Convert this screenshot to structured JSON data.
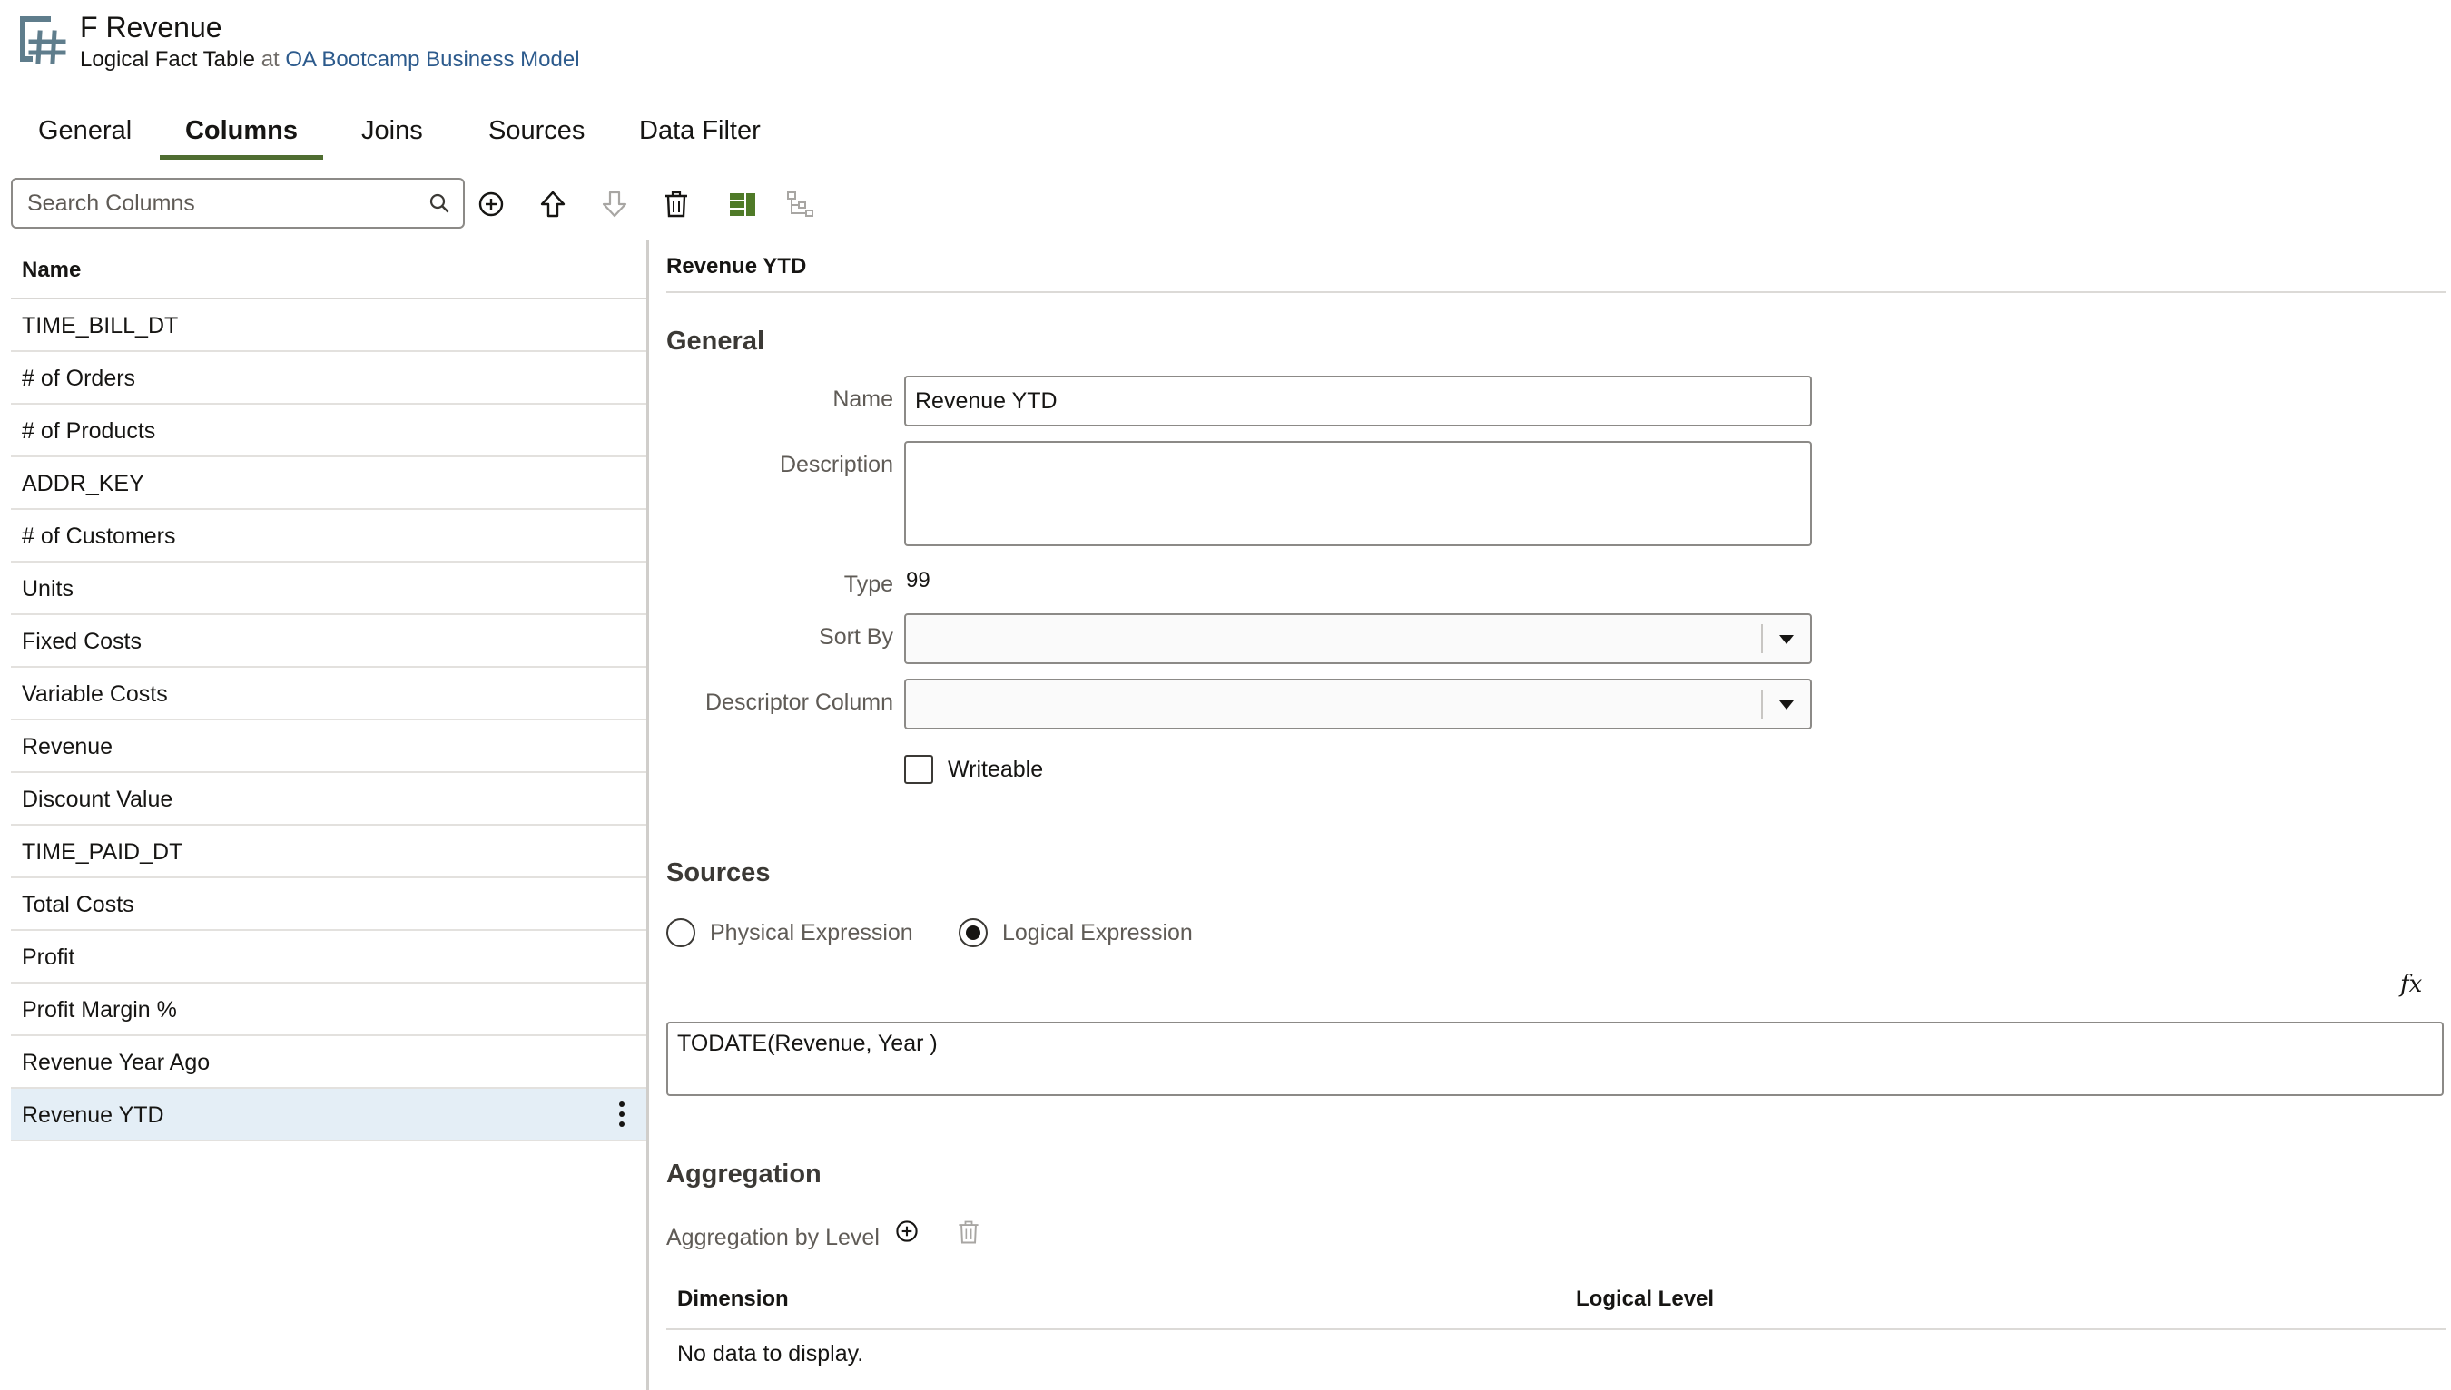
{
  "header": {
    "title": "F Revenue",
    "subtitle_type": "Logical Fact Table",
    "subtitle_at": "at",
    "subtitle_link": "OA Bootcamp Business Model"
  },
  "tabs": [
    {
      "label": "General"
    },
    {
      "label": "Columns"
    },
    {
      "label": "Joins"
    },
    {
      "label": "Sources"
    },
    {
      "label": "Data Filter"
    }
  ],
  "active_tab": "Columns",
  "toolbar": {
    "search_placeholder": "Search Columns",
    "icons": [
      "search-icon",
      "add-circle-icon",
      "move-up-icon",
      "move-down-icon",
      "delete-icon",
      "columns-view-icon",
      "hierarchy-icon"
    ]
  },
  "columns_list": {
    "header": "Name",
    "items": [
      "TIME_BILL_DT",
      "# of Orders",
      "# of Products",
      "ADDR_KEY",
      "# of Customers",
      "Units",
      "Fixed Costs",
      "Variable Costs",
      "Revenue",
      "Discount Value",
      "TIME_PAID_DT",
      "Total Costs",
      "Profit",
      "Profit Margin %",
      "Revenue Year Ago",
      "Revenue YTD"
    ],
    "selected": "Revenue YTD"
  },
  "detail": {
    "title": "Revenue YTD",
    "general": {
      "heading": "General",
      "name_label": "Name",
      "name_value": "Revenue YTD",
      "description_label": "Description",
      "description_value": "",
      "type_label": "Type",
      "type_value": "99",
      "sort_by_label": "Sort By",
      "sort_by_value": "",
      "descriptor_label": "Descriptor Column",
      "descriptor_value": "",
      "writeable_label": "Writeable",
      "writeable_checked": false
    },
    "sources": {
      "heading": "Sources",
      "physical_label": "Physical Expression",
      "logical_label": "Logical Expression",
      "selected": "Logical Expression",
      "fx_label": "fx",
      "expression": "TODATE(Revenue, Year )"
    },
    "aggregation": {
      "heading": "Aggregation",
      "by_level_label": "Aggregation by Level",
      "col_dimension": "Dimension",
      "col_logical_level": "Logical Level",
      "empty_text": "No data to display."
    }
  },
  "colors": {
    "accent_tab": "#4f6d31",
    "link": "#2c5a8c",
    "selected_row": "#e4eef6",
    "icon_green": "#4f7a28"
  }
}
